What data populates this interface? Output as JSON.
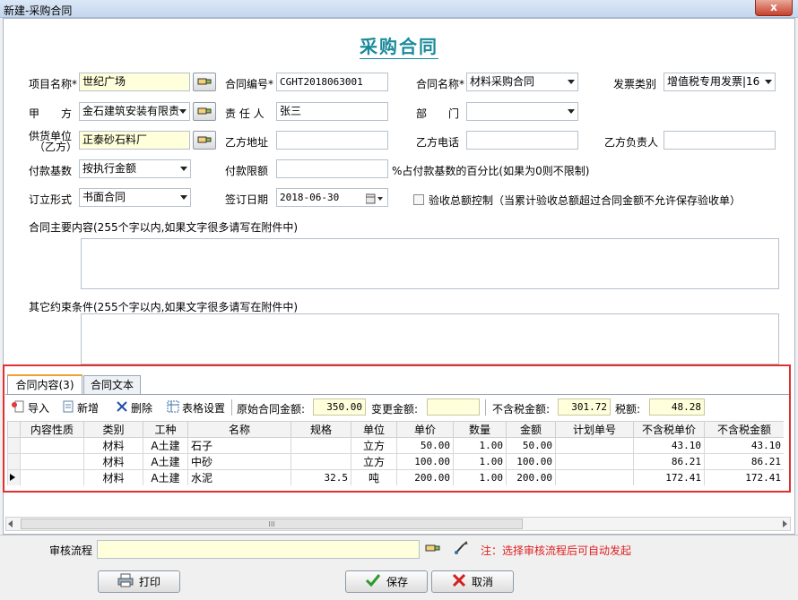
{
  "window": {
    "title": "新建-采购合同",
    "close_label": "x"
  },
  "form": {
    "heading": "采购合同",
    "project_name": {
      "label": "项目名称*",
      "value": "世纪广场"
    },
    "contract_no": {
      "label": "合同编号*",
      "value": "CGHT2018063001"
    },
    "contract_name": {
      "label": "合同名称*",
      "value": "材料采购合同"
    },
    "invoice_type": {
      "label": "发票类别",
      "value": "增值税专用发票|16"
    },
    "party_a": {
      "label": "甲　　方",
      "value": "金石建筑安装有限责"
    },
    "person_in_charge": {
      "label": "责 任 人",
      "value": "张三"
    },
    "department": {
      "label": "部　　门",
      "value": ""
    },
    "supplier": {
      "label_line1": "供货单位",
      "label_line2": "（乙方）",
      "value": "正泰砂石料厂"
    },
    "party_b_address": {
      "label": "乙方地址",
      "value": ""
    },
    "party_b_phone": {
      "label": "乙方电话",
      "value": ""
    },
    "party_b_manager": {
      "label": "乙方负责人",
      "value": ""
    },
    "payment_base": {
      "label": "付款基数",
      "value": "按执行金额"
    },
    "payment_limit": {
      "label": "付款限额",
      "value": "",
      "note": "%占付款基数的百分比(如果为0则不限制)"
    },
    "sign_form": {
      "label": "订立形式",
      "value": "书面合同"
    },
    "sign_date": {
      "label": "签订日期",
      "value": "2018-06-30"
    },
    "acceptance_control": {
      "label": "验收总额控制（当累计验收总额超过合同金额不允许保存验收单）",
      "checked": false
    },
    "main_content_label": "合同主要内容(255个字以内,如果文字很多请写在附件中)",
    "other_terms_label": "其它约束条件(255个字以内,如果文字很多请写在附件中)"
  },
  "tabs": [
    {
      "label": "合同内容(3)",
      "active": true
    },
    {
      "label": "合同文本",
      "active": false
    }
  ],
  "toolbar": {
    "import_label": "导入",
    "add_label": "新增",
    "delete_label": "删除",
    "table_settings_label": "表格设置",
    "original_amount_label": "原始合同金额:",
    "original_amount_value": "350.00",
    "change_amount_label": "变更金额:",
    "change_amount_value": "",
    "excl_tax_label": "不含税金额:",
    "excl_tax_value": "301.72",
    "tax_label": "税额:",
    "tax_value": "48.28"
  },
  "table": {
    "headers": [
      "内容性质",
      "类别",
      "工种",
      "名称",
      "规格",
      "单位",
      "单价",
      "数量",
      "金额",
      "计划单号",
      "不含税单价",
      "不含税金额"
    ],
    "rows": [
      {
        "selected": false,
        "cells": [
          "",
          "材料",
          "A土建",
          "石子",
          "",
          "立方",
          "50.00",
          "1.00",
          "50.00",
          "",
          "43.10",
          "43.10"
        ]
      },
      {
        "selected": false,
        "cells": [
          "",
          "材料",
          "A土建",
          "中砂",
          "",
          "立方",
          "100.00",
          "1.00",
          "100.00",
          "",
          "86.21",
          "86.21"
        ]
      },
      {
        "selected": true,
        "cells": [
          "",
          "材料",
          "A土建",
          "水泥",
          "32.5",
          "吨",
          "200.00",
          "1.00",
          "200.00",
          "",
          "172.41",
          "172.41"
        ]
      }
    ]
  },
  "scrollbar": {
    "grip": "III"
  },
  "footer": {
    "workflow_label": "审核流程",
    "workflow_value": "",
    "workflow_note": "注：选择审核流程后可自动发起",
    "print_label": "打印",
    "save_label": "保存",
    "cancel_label": "取消"
  },
  "colors": {
    "title": "#1a8a9a",
    "highlight_border": "#e03030",
    "note": "#e02020",
    "yellow_field": "#ffffdc"
  },
  "icons": [
    "pick-hand-icon",
    "calendar-icon",
    "import-icon",
    "add-document-icon",
    "delete-x-icon",
    "table-settings-icon",
    "brush-icon",
    "printer-icon",
    "save-check-icon",
    "cancel-x-icon",
    "row-pointer-icon"
  ]
}
